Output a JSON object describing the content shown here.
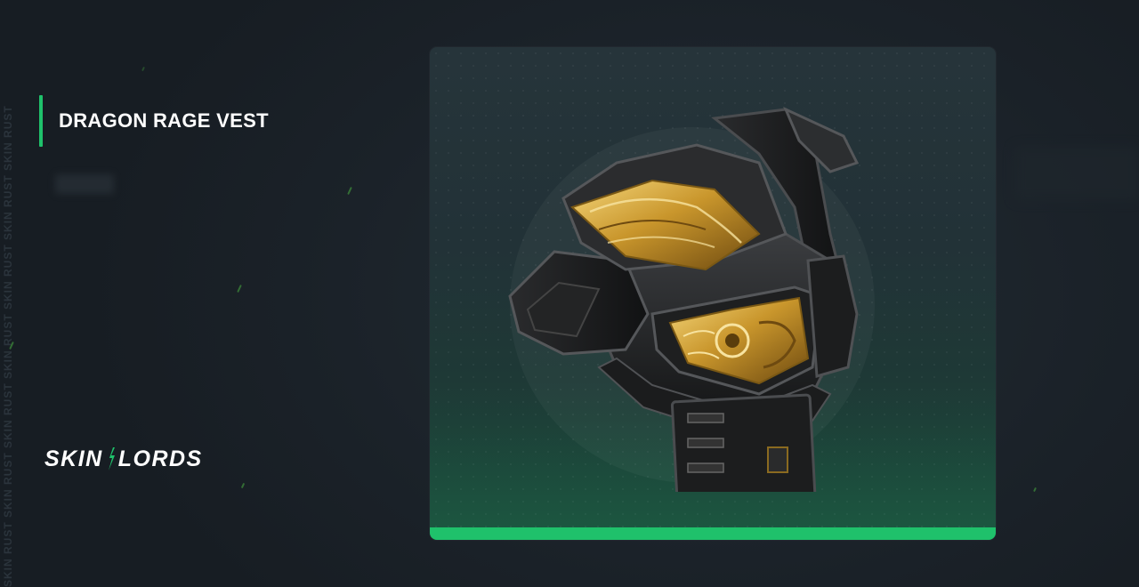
{
  "item": {
    "name": "DRAGON RAGE VEST"
  },
  "brand": {
    "logo_left": "SKIN",
    "logo_right": "LORDS",
    "accent_color": "#1fc16b"
  },
  "watermark": {
    "text": "SKIN RUST SKIN RUST SKIN RUST SKIN RUST SKIN RUST SKIN RUST SKIN RUST"
  },
  "icons": {
    "item_image": "armored-vest-gold-dragon"
  }
}
